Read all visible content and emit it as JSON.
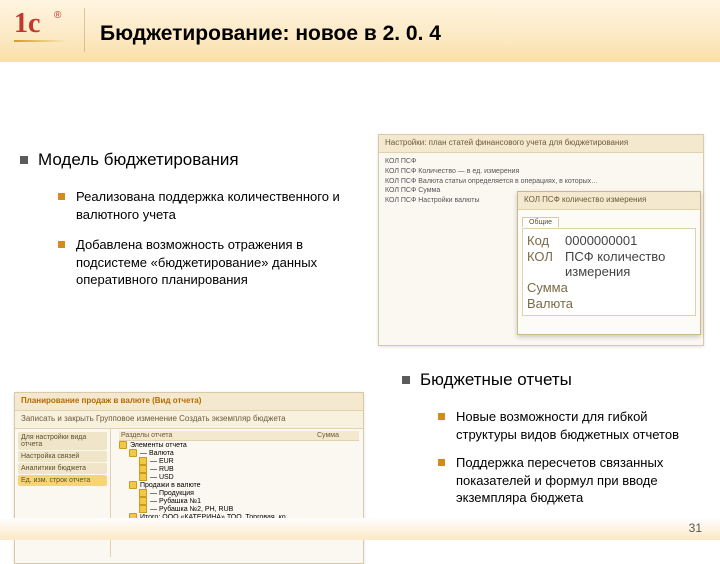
{
  "title": "Бюджетирование: новое в 2. 0. 4",
  "page_number": "31",
  "section1": {
    "heading": "Модель бюджетирования",
    "bullets": [
      "Реализована поддержка количественного и валютного учета",
      "Добавлена возможность отражения в подсистеме «бюджетирование» данных оперативного планирования"
    ]
  },
  "section2": {
    "heading": "Бюджетные отчеты",
    "bullets": [
      "Новые возможности для гибкой структуры видов бюджетных отчетов",
      "Поддержка пересчетов связанных показателей и формул при вводе экземпляра бюджета"
    ]
  },
  "shot1": {
    "title": "Настройки: план статей финансового учета для бюджетирования",
    "lines": [
      "КОЛ  ПСФ",
      "КОЛ  ПСФ Количество — в ед. измерения",
      "КОЛ  ПСФ Валюта статьи определяется в операциях, в которых…",
      "КОЛ  ПСФ Сумма",
      "КОЛ  ПСФ Настройки валюты"
    ],
    "sub": {
      "title": "КОЛ  ПСФ количество измерения",
      "tab": "Общие",
      "fields": [
        [
          "Код",
          "0000000001"
        ],
        [
          "КОЛ",
          "ПСФ количество измерения"
        ],
        [
          "Сумма",
          ""
        ],
        [
          "Валюта",
          ""
        ]
      ]
    }
  },
  "shot2": {
    "title": "Планирование продаж в валюте (Вид отчета)",
    "toolbar": "Записать и закрыть    Групповое изменение    Создать экземпляр бюджета",
    "side": [
      "Для настройки вида отчета",
      "Настройка связей",
      "Аналитики бюджета",
      "Ед. изм. строк отчета"
    ],
    "grid_head": [
      "Разделы отчета",
      "Сумма"
    ],
    "tree": [
      "Элементы отчета",
      "— Валюта",
      "— EUR",
      "— RUB",
      "— USD",
      "Продажи в валюте",
      "— Продукция",
      "— Рубашка №1",
      "— Рубашка №2, PH, RUB",
      "Итого: ООО «КАТЕРИНА» ТОО, Торговая, ко…"
    ]
  }
}
